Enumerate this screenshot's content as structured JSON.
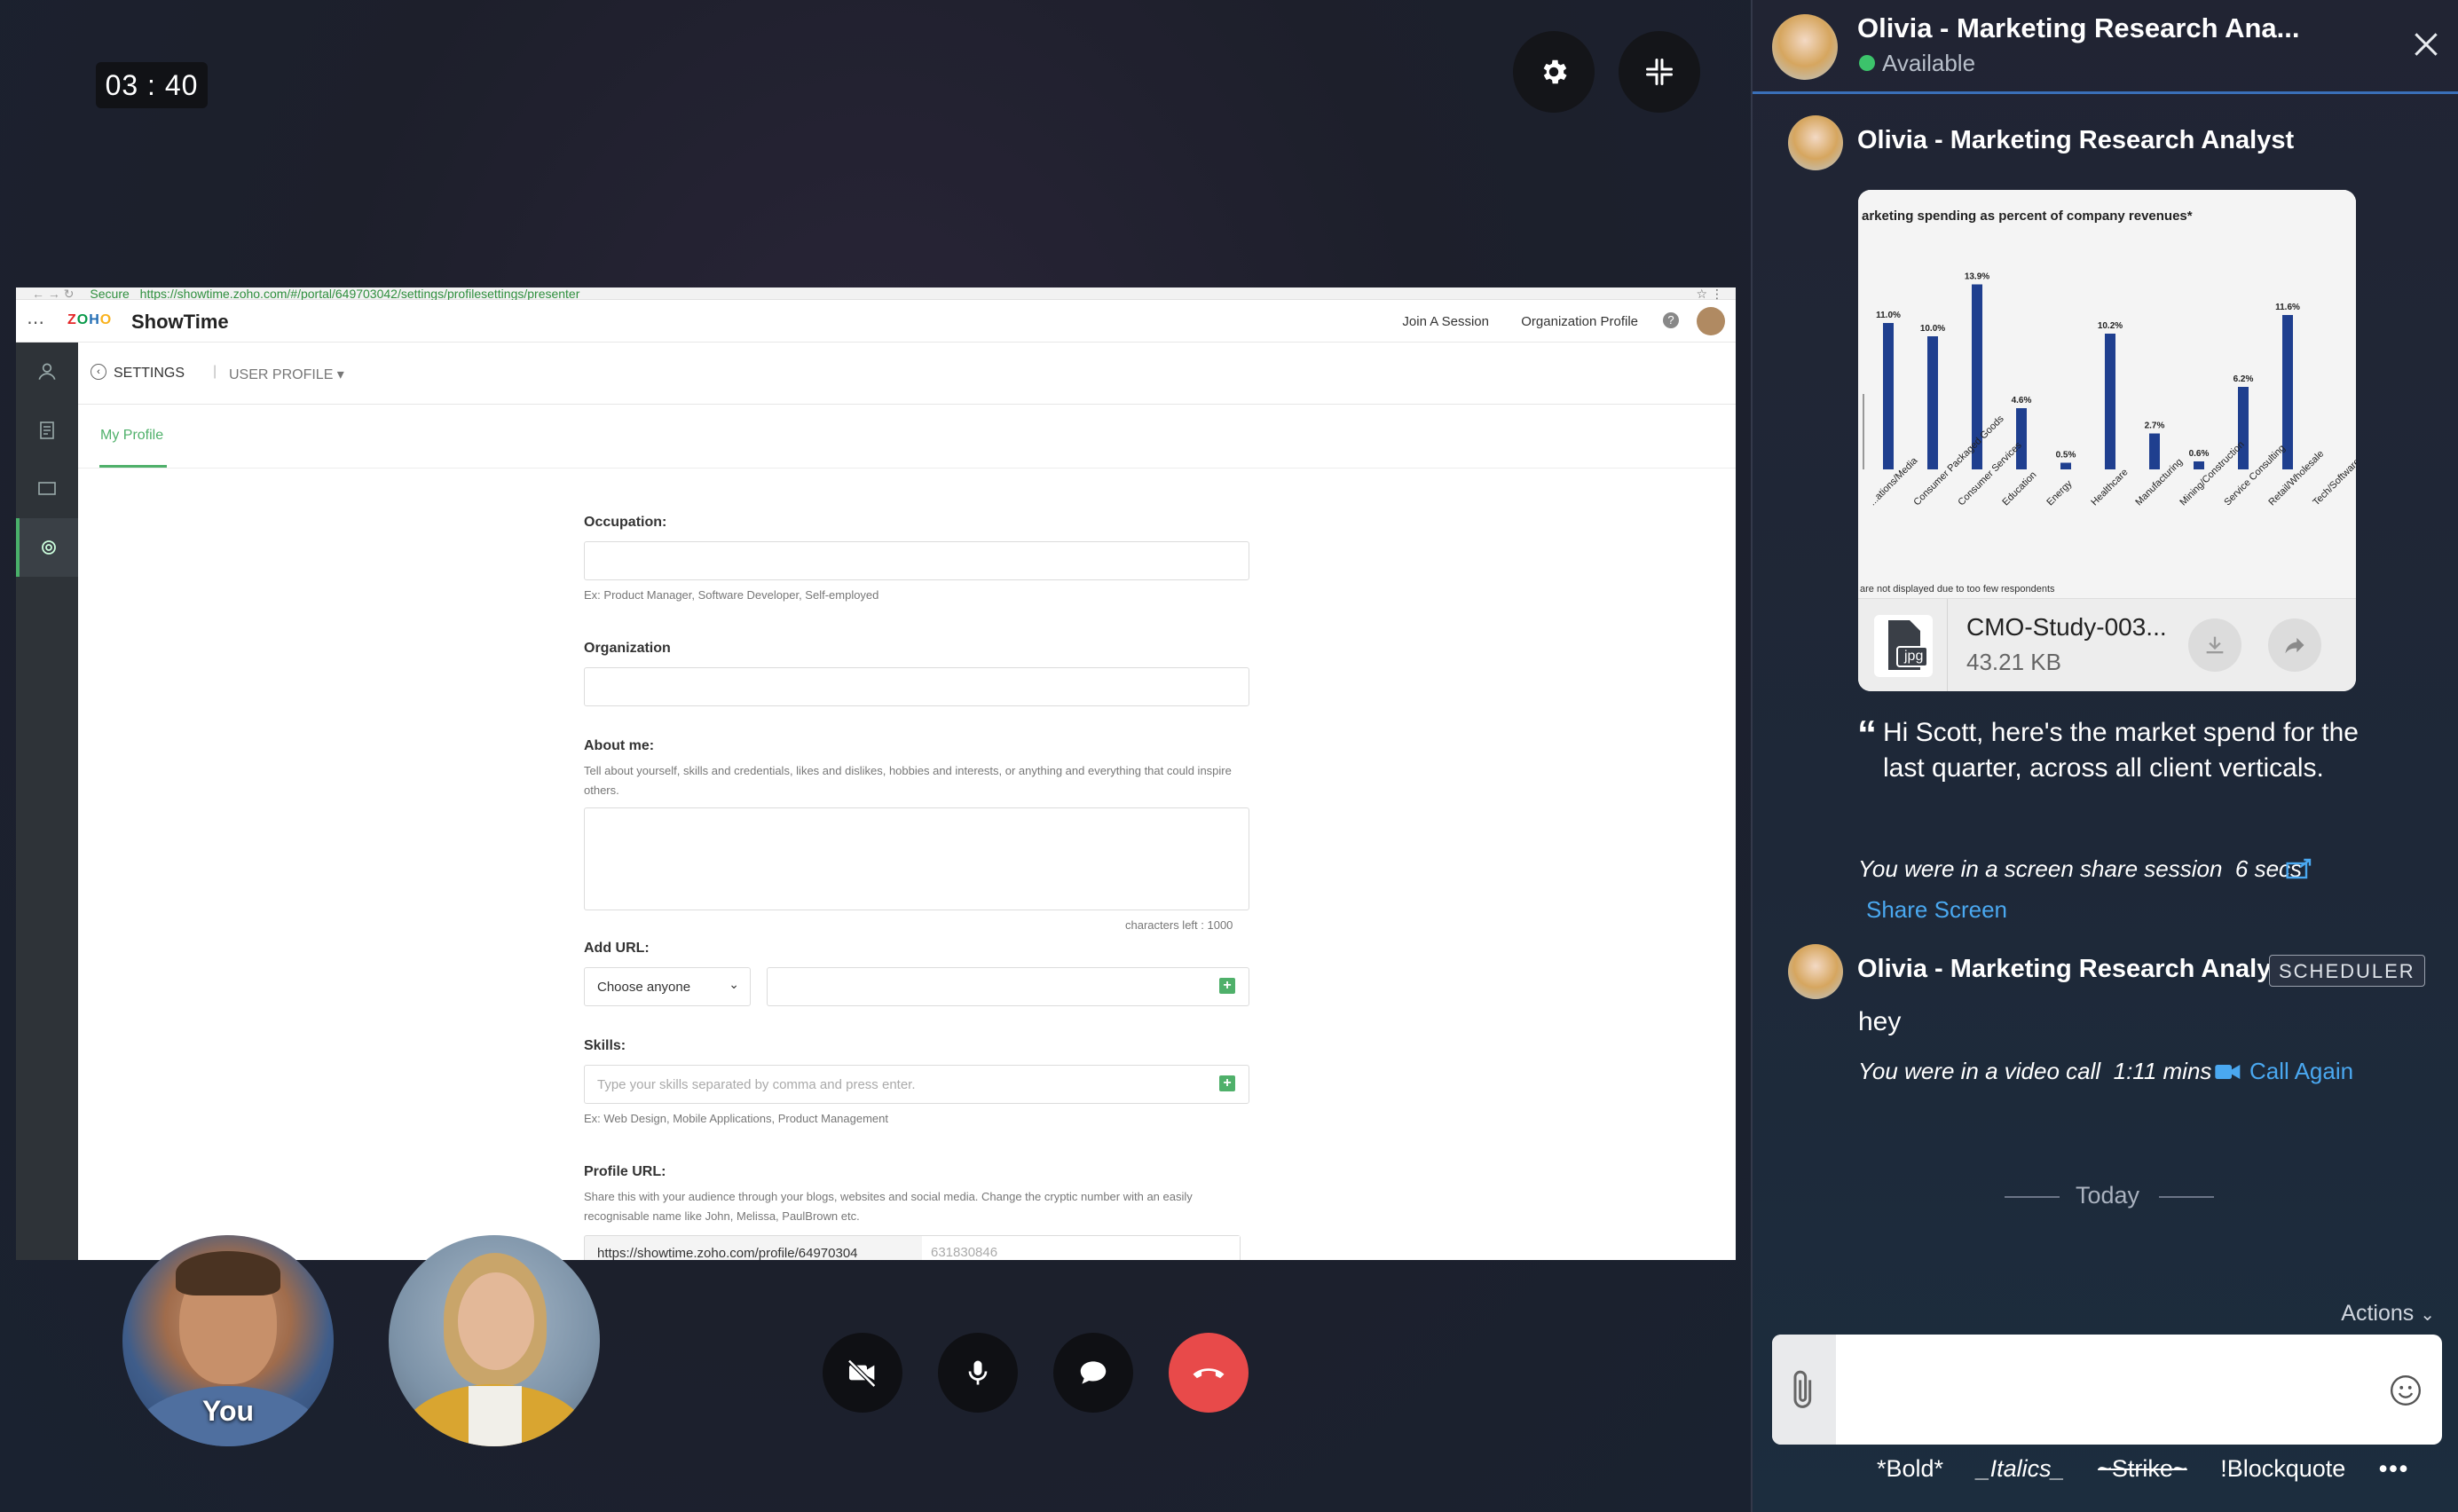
{
  "call": {
    "timer": "03 : 40",
    "self_label": "You"
  },
  "shared_screen": {
    "url_secure": "Secure",
    "url": "https://showtime.zoho.com/#/portal/649703042/settings/profilesettings/presenter",
    "logo_zoho": "ZOHO",
    "app_name": "ShowTime",
    "header_links": [
      "Join A Session",
      "Organization Profile"
    ],
    "settings_label": "SETTINGS",
    "user_profile_label": "USER PROFILE ▾",
    "tab_my_profile": "My Profile",
    "occupation_label": "Occupation:",
    "occupation_hint": "Ex: Product Manager, Software Developer, Self-employed",
    "organization_label": "Organization",
    "about_label": "About me:",
    "about_hint": "Tell about yourself, skills and credentials, likes and dislikes, hobbies and interests, or anything and everything that could inspire others.",
    "chars_left": "characters left : 1000",
    "add_url_label": "Add URL:",
    "url_select": "Choose anyone",
    "skills_label": "Skills:",
    "skills_placeholder": "Type your skills separated by comma and press enter.",
    "skills_hint": "Ex: Web Design, Mobile Applications, Product Management",
    "profile_url_label": "Profile URL:",
    "profile_url_hint": "Share this with your audience through your blogs, websites and social media. Change the cryptic number with an easily recognisable name like John, Melissa, PaulBrown etc.",
    "profile_url_prefix": "https://showtime.zoho.com/profile/64970304",
    "profile_url_suffix": "631830846"
  },
  "chat": {
    "contact_name": "Olivia - Marketing Research Ana...",
    "status": "Available",
    "status_color": "#3cc36b",
    "accent": "#4aa8f0",
    "message1_sender": "Olivia - Marketing Research Analyst",
    "attachment": {
      "chart_title": "arketing spending as percent of company revenues*",
      "file_name": "CMO-Study-003...",
      "file_size": "43.21 KB",
      "file_type": "jpg",
      "footnote": "are not displayed due to too few respondents"
    },
    "quote": "Hi Scott, here's the market spend for the last quarter, across all client verticals.",
    "screen_share_note": "You were in a screen share session",
    "screen_share_duration": "6 secs",
    "share_screen_link": "Share Screen",
    "message2_sender": "Olivia - Marketing Research Analyst",
    "message2_badge": "SCHEDULER",
    "message2_text": "hey",
    "video_call_note": "You were in a video call",
    "video_call_duration": "1:11 mins",
    "call_again_link": "Call Again",
    "day_divider": "Today",
    "actions_label": "Actions",
    "formatting": [
      "*Bold*",
      "_Italics_",
      "~Strike~",
      "!Blockquote"
    ]
  },
  "chart_data": {
    "type": "bar",
    "title": "arketing spending as percent of company revenues*",
    "categories": [
      "...ations/Media",
      "Consumer Packaged Goods",
      "Consumer Services",
      "Education",
      "Energy",
      "Healthcare",
      "Manufacturing",
      "Mining/Construction",
      "Service Consulting",
      "Retail/Wholesale",
      "Tech/Software/B..."
    ],
    "values": [
      11.0,
      10.0,
      13.9,
      4.6,
      0.5,
      10.2,
      2.7,
      0.6,
      6.2,
      11.6
    ],
    "value_labels": [
      "11.0%",
      "10.0%",
      "13.9%",
      "4.6%",
      "0.5%",
      "10.2%",
      "2.7%",
      "0.6%",
      "6.2%",
      "11.6%"
    ],
    "bar_color": "#1f3f8f",
    "ylim": [
      0,
      15
    ]
  }
}
